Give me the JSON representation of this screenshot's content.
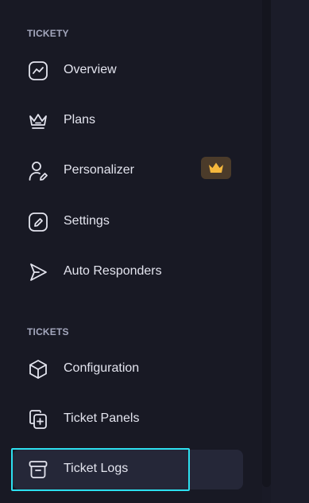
{
  "sections": {
    "tickety": {
      "title": "TICKETY"
    },
    "tickets": {
      "title": "TICKETS"
    }
  },
  "items": {
    "overview": {
      "label": "Overview",
      "icon": "chart-line-icon"
    },
    "plans": {
      "label": "Plans",
      "icon": "crown-outline-icon"
    },
    "personalizer": {
      "label": "Personalizer",
      "icon": "user-edit-icon",
      "badge_icon": "crown-icon",
      "badge_color": "#f5b83d"
    },
    "settings": {
      "label": "Settings",
      "icon": "edit-square-icon"
    },
    "auto_responders": {
      "label": "Auto Responders",
      "icon": "send-icon"
    },
    "configuration": {
      "label": "Configuration",
      "icon": "cube-icon"
    },
    "ticket_panels": {
      "label": "Ticket Panels",
      "icon": "copy-plus-icon"
    },
    "ticket_logs": {
      "label": "Ticket Logs",
      "icon": "archive-icon",
      "active": true
    }
  },
  "colors": {
    "background": "#181924",
    "text": "#e3e4ee",
    "section_title": "#a4a7bd",
    "active_bg": "#252738",
    "focus_ring": "#2de0f0",
    "badge_bg": "#4b3b2a",
    "badge_icon": "#f5b83d"
  }
}
